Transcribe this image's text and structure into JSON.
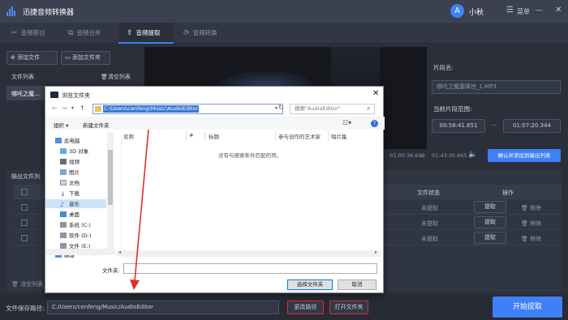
{
  "app": {
    "title": "迅捷音频转换器"
  },
  "user": {
    "name": "小秋",
    "avatar_glyph": "A"
  },
  "window": {
    "menu_label": "菜单",
    "minimize": "—",
    "close": "✕"
  },
  "tabs": [
    {
      "label": "音频剪切",
      "icon": "scissors-icon",
      "active": false
    },
    {
      "label": "音频合并",
      "icon": "merge-icon",
      "active": false
    },
    {
      "label": "音频提取",
      "icon": "extract-icon",
      "active": true
    },
    {
      "label": "音频转换",
      "icon": "convert-icon",
      "active": false
    }
  ],
  "left_panel": {
    "add_file": "添加文件",
    "add_folder": "添加文件夹",
    "file_list_label": "文件列表",
    "clear_list": "清空列表",
    "file_item": "哪吒之魔..."
  },
  "player": {
    "time_current": "01:00:36.699",
    "time_total": "01:43:30.665",
    "confirm_add": "确认并添加到输出列表"
  },
  "right_panel": {
    "segment_name_label": "片段名:",
    "segment_name_value": "哪吒之魔童降世_1.MP3",
    "range_label": "当前片段范围:",
    "range_start": "00:58:41.651",
    "range_end": "01:07:20.344",
    "range_dash": "—"
  },
  "output": {
    "label": "输出文件列",
    "status_header": "文件状态",
    "action_header": "操作",
    "rows": [
      {
        "status": "未提取",
        "extract": "提取",
        "remove": "移除"
      },
      {
        "status": "未提取",
        "extract": "提取",
        "remove": "移除"
      },
      {
        "status": "未提取",
        "extract": "提取",
        "remove": "移除"
      }
    ],
    "clear_list": "清空列表"
  },
  "footer": {
    "save_path_label": "文件保存路径:",
    "save_path_value": "C:/Users/cenfeng/Music/AudioEditor",
    "change_path": "更改路径",
    "open_folder": "打开文件夹",
    "start_extract": "开始提取"
  },
  "dialog": {
    "title": "浏览文件夹",
    "address": "C:\\Users\\cenfeng\\Music\\AudioEditor",
    "search_placeholder": "搜索\"AudioEditor\"",
    "organize": "组织 ▾",
    "new_folder": "新建文件夹",
    "tree": [
      {
        "label": "此电脑",
        "icon": "computer-icon"
      },
      {
        "label": "3D 对象",
        "icon": "cube-icon"
      },
      {
        "label": "视频",
        "icon": "video-icon"
      },
      {
        "label": "图片",
        "icon": "picture-icon"
      },
      {
        "label": "文档",
        "icon": "document-icon"
      },
      {
        "label": "下载",
        "icon": "download-icon"
      },
      {
        "label": "音乐",
        "icon": "music-icon",
        "selected": true
      },
      {
        "label": "桌面",
        "icon": "desktop-icon"
      },
      {
        "label": "系统 (C:)",
        "icon": "drive-icon"
      },
      {
        "label": "软件 (D:)",
        "icon": "drive-icon"
      },
      {
        "label": "文件 (E:)",
        "icon": "drive-icon"
      },
      {
        "label": "网络",
        "icon": "network-icon"
      }
    ],
    "columns": {
      "name": "名称",
      "number": "#",
      "title": "标题",
      "artist": "参与创作的艺术家",
      "album": "唱片集"
    },
    "empty_message": "没有与搜索条件匹配的项。",
    "folder_label": "文件夹:",
    "folder_value": "",
    "select_folder": "选择文件夹",
    "cancel": "取消"
  },
  "colors": {
    "accent": "#3f7ff7",
    "annotation": "#e0302a",
    "bg": "#2a2f3a"
  }
}
